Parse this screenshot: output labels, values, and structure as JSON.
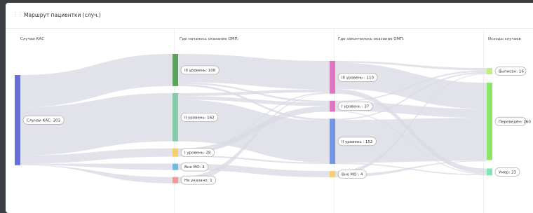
{
  "widget": {
    "title": "Маршрут пациентки (случ.)",
    "drag_icon": "drag-handle-icon"
  },
  "columns": [
    "Случаи КАС",
    "Где началось оказание ОМП:",
    "Где закончилось оказание ОМП:",
    "Исходы случаев"
  ],
  "chart_data": {
    "type": "sankey",
    "nodes": [
      {
        "id": "src",
        "col": 0,
        "label": "Случаи КАС: 303",
        "value": 303,
        "color": "#6670d6"
      },
      {
        "id": "s_l3",
        "col": 1,
        "label": "III уровень: 108",
        "value": 108,
        "color": "#5aa25a"
      },
      {
        "id": "s_l2",
        "col": 1,
        "label": "II уровень: 162",
        "value": 162,
        "color": "#86cba7"
      },
      {
        "id": "s_l1",
        "col": 1,
        "label": "I уровень: 28",
        "value": 28,
        "color": "#f4cf72"
      },
      {
        "id": "s_out",
        "col": 1,
        "label": "Вне МО: 4",
        "value": 4,
        "color": "#6fb7dc"
      },
      {
        "id": "s_na",
        "col": 1,
        "label": "Не указано: 1",
        "value": 1,
        "color": "#f29a9a"
      },
      {
        "id": "e_l3",
        "col": 2,
        "label": "III уровень : 110",
        "value": 110,
        "color": "#dd77c0"
      },
      {
        "id": "e_l1",
        "col": 2,
        "label": "I уровень : 37",
        "value": 37,
        "color": "#dd77c0"
      },
      {
        "id": "e_l2",
        "col": 2,
        "label": "II уровень : 152",
        "value": 152,
        "color": "#7597df"
      },
      {
        "id": "e_out",
        "col": 2,
        "label": "Вне МО : 4",
        "value": 4,
        "color": "#f4cf72"
      },
      {
        "id": "o_disc",
        "col": 3,
        "label": "Выписан: 16",
        "value": 16,
        "color": "#c4ee7c"
      },
      {
        "id": "o_trans",
        "col": 3,
        "label": "Переведён: 260",
        "value": 260,
        "color": "#8ae769"
      },
      {
        "id": "o_dead",
        "col": 3,
        "label": "Умер: 23",
        "value": 23,
        "color": "#7fe7b4"
      }
    ],
    "links": [
      {
        "source": "src",
        "target": "s_l3",
        "value": 108
      },
      {
        "source": "src",
        "target": "s_l2",
        "value": 162
      },
      {
        "source": "src",
        "target": "s_l1",
        "value": 28
      },
      {
        "source": "src",
        "target": "s_out",
        "value": 4
      },
      {
        "source": "src",
        "target": "s_na",
        "value": 1
      },
      {
        "source": "s_l3",
        "target": "e_l3",
        "value": 95
      },
      {
        "source": "s_l3",
        "target": "e_l1",
        "value": 6
      },
      {
        "source": "s_l3",
        "target": "e_l2",
        "value": 7
      },
      {
        "source": "s_l2",
        "target": "e_l3",
        "value": 10
      },
      {
        "source": "s_l2",
        "target": "e_l1",
        "value": 12
      },
      {
        "source": "s_l2",
        "target": "e_l2",
        "value": 140
      },
      {
        "source": "s_l1",
        "target": "e_l1",
        "value": 19
      },
      {
        "source": "s_l1",
        "target": "e_l3",
        "value": 4
      },
      {
        "source": "s_l1",
        "target": "e_l2",
        "value": 5
      },
      {
        "source": "s_out",
        "target": "e_out",
        "value": 4
      },
      {
        "source": "s_na",
        "target": "e_l3",
        "value": 1
      },
      {
        "source": "e_l3",
        "target": "o_disc",
        "value": 6
      },
      {
        "source": "e_l3",
        "target": "o_trans",
        "value": 88
      },
      {
        "source": "e_l3",
        "target": "o_dead",
        "value": 16
      },
      {
        "source": "e_l1",
        "target": "o_disc",
        "value": 4
      },
      {
        "source": "e_l1",
        "target": "o_trans",
        "value": 30
      },
      {
        "source": "e_l1",
        "target": "o_dead",
        "value": 3
      },
      {
        "source": "e_l2",
        "target": "o_disc",
        "value": 4
      },
      {
        "source": "e_l2",
        "target": "o_trans",
        "value": 144
      },
      {
        "source": "e_l2",
        "target": "o_dead",
        "value": 4
      },
      {
        "source": "e_out",
        "target": "o_disc",
        "value": 2
      },
      {
        "source": "e_out",
        "target": "o_trans",
        "value": 2
      }
    ]
  }
}
